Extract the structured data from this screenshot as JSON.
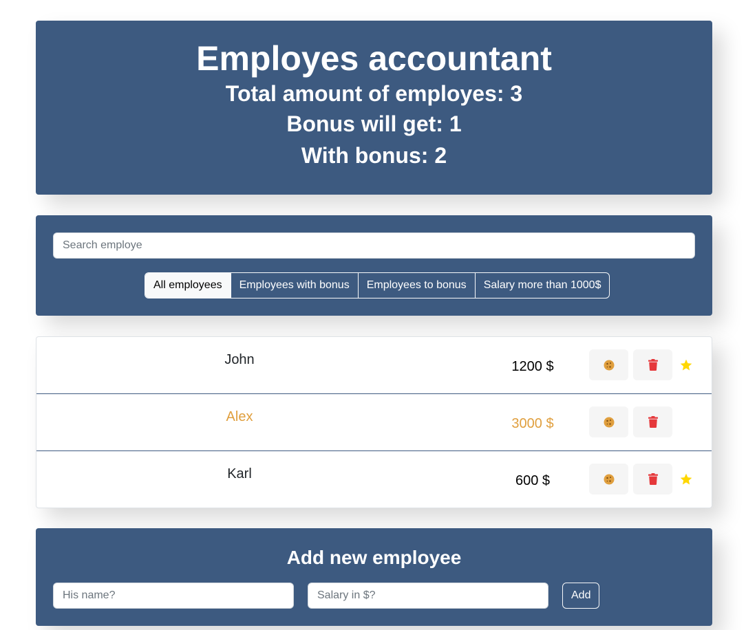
{
  "header": {
    "title": "Employes accountant",
    "total_line": "Total amount of employes: 3",
    "bonus_line": "Bonus will get: 1",
    "with_bonus_line": "With bonus: 2"
  },
  "search": {
    "placeholder": "Search employe",
    "value": ""
  },
  "filters": [
    {
      "label": "All employees",
      "active": true
    },
    {
      "label": "Employees with bonus",
      "active": false
    },
    {
      "label": "Employees to bonus",
      "active": false
    },
    {
      "label": "Salary more than 1000$",
      "active": false
    }
  ],
  "employees": [
    {
      "name": "John",
      "salary": "1200 $",
      "increase": false,
      "starred": true
    },
    {
      "name": "Alex",
      "salary": "3000 $",
      "increase": true,
      "starred": false
    },
    {
      "name": "Karl",
      "salary": "600 $",
      "increase": false,
      "starred": true
    }
  ],
  "colors": {
    "panel": "#3d5a80",
    "cookie": "#e09f3e",
    "trash": "#e5383b",
    "star": "#ffd700"
  },
  "icons": {
    "cookie": "cookie-icon",
    "trash": "trash-icon",
    "star": "star-icon"
  },
  "add_form": {
    "title": "Add new employee",
    "name_placeholder": "His name?",
    "salary_placeholder": "Salary in $?",
    "submit_label": "Add"
  }
}
